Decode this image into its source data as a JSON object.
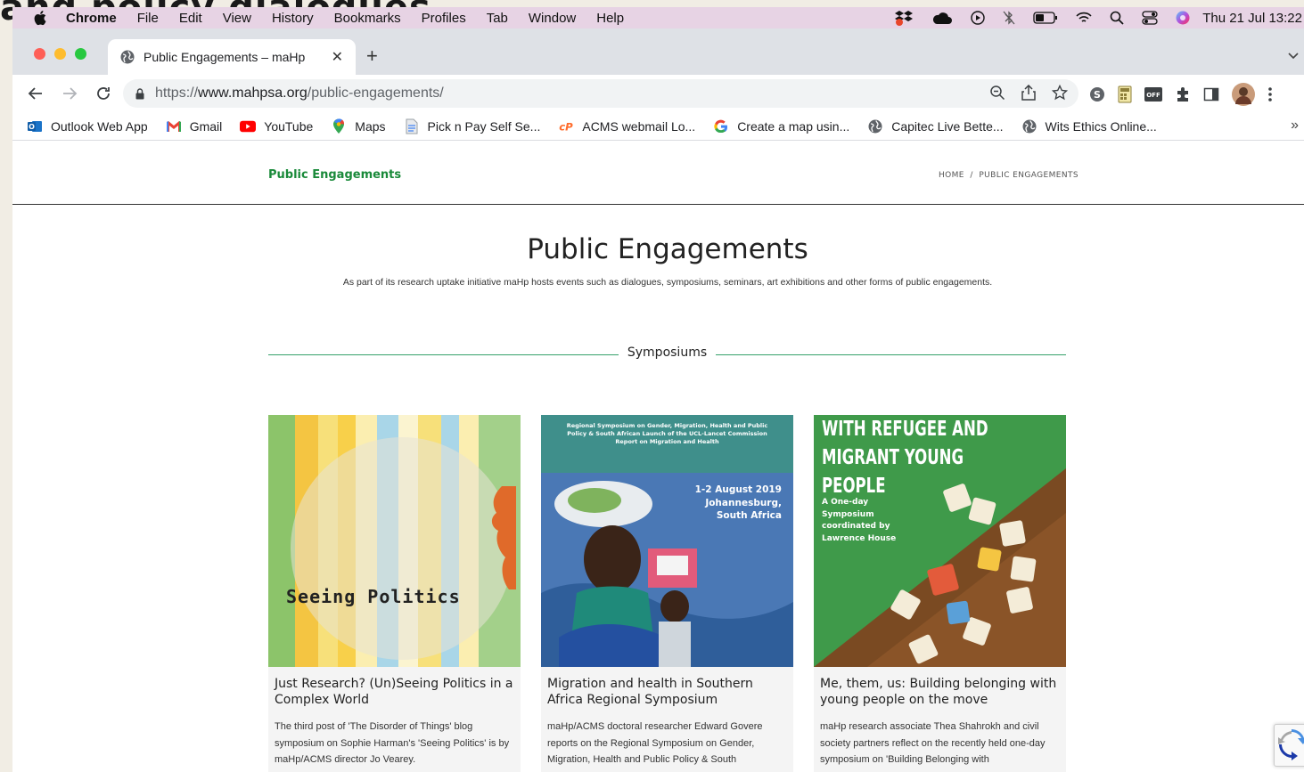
{
  "background_text": "and policy dialogues",
  "menubar": {
    "app_name": "Chrome",
    "items": [
      "File",
      "Edit",
      "View",
      "History",
      "Bookmarks",
      "Profiles",
      "Tab",
      "Window",
      "Help"
    ],
    "clock": "Thu 21 Jul  13:22"
  },
  "browser": {
    "tab_title": "Public Engagements – maHp",
    "url_scheme": "https://",
    "url_host": "www.mahpsa.org",
    "url_path": "/public-engagements/",
    "bookmarks": [
      {
        "label": "Outlook Web App",
        "icon": "outlook-icon"
      },
      {
        "label": "Gmail",
        "icon": "gmail-icon"
      },
      {
        "label": "YouTube",
        "icon": "youtube-icon"
      },
      {
        "label": "Maps",
        "icon": "maps-icon"
      },
      {
        "label": "Pick n Pay Self Se...",
        "icon": "document-icon"
      },
      {
        "label": "ACMS webmail Lo...",
        "icon": "cpanel-icon"
      },
      {
        "label": "Create a map usin...",
        "icon": "google-icon"
      },
      {
        "label": "Capitec Live Bette...",
        "icon": "globe-icon"
      },
      {
        "label": "Wits Ethics Online...",
        "icon": "globe-icon"
      }
    ]
  },
  "page": {
    "title_bar": "Public Engagements",
    "breadcrumb_home": "HOME",
    "breadcrumb_sep": "/",
    "breadcrumb_current": "PUBLIC ENGAGEMENTS",
    "heading": "Public Engagements",
    "subheading": "As part of its research uptake initiative maHp hosts events such as dialogues, symposiums, seminars, art exhibitions and other forms of public engagements.",
    "section_label": "Symposiums",
    "cards": [
      {
        "image_text": "Seeing Politics",
        "title": "Just Research? (Un)Seeing Politics in a Complex World",
        "excerpt": "The third post of 'The Disorder of Things' blog symposium on Sophie Harman's 'Seeing Politics' is by maHp/ACMS director Jo Vearey."
      },
      {
        "image_header": "Regional Symposium on Gender, Migration, Health and Public Policy & South African Launch of the UCL-Lancet Commission Report on Migration and Health",
        "image_date": "1-2 August 2019 Johannesburg, South Africa",
        "title": "Migration and health in Southern Africa Regional Symposium",
        "excerpt": "maHp/ACMS doctoral researcher Edward Govere reports on the Regional Symposium on Gender, Migration, Health and Public Policy & South"
      },
      {
        "image_header_line1": "WITH REFUGEE AND",
        "image_header_line2": "MIGRANT YOUNG",
        "image_header_line3": "PEOPLE",
        "image_sub": "A One-day Symposium coordinated by Lawrence House",
        "title": "Me, them, us: Building belonging with young people on the move",
        "excerpt": "maHp research associate Thea Shahrokh and civil society partners reflect on the recently held one-day symposium on 'Building Belonging with"
      }
    ]
  },
  "colors": {
    "menubar_bg": "#e7d3e4",
    "accent_green": "#1a8a3a",
    "divider_green": "#35a06a"
  }
}
